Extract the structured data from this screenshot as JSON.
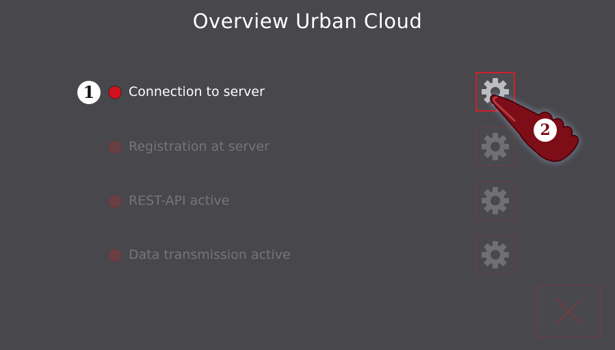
{
  "title": "Overview Urban Cloud",
  "status_items": [
    {
      "label": "Connection to server",
      "active": true
    },
    {
      "label": "Registration at server",
      "active": false
    },
    {
      "label": "REST-API active",
      "active": false
    },
    {
      "label": "Data transmission active",
      "active": false
    }
  ],
  "callouts": {
    "step1": "1",
    "step2": "2"
  },
  "icons": {
    "settings": "gear-icon",
    "close": "close-icon",
    "pointer": "pointing-hand-icon"
  },
  "colors": {
    "background": "#47474c",
    "status_active": "#d0101a",
    "status_inactive": "#6a3f44",
    "accent_border": "#d02028",
    "hand": "#7d0c12"
  }
}
